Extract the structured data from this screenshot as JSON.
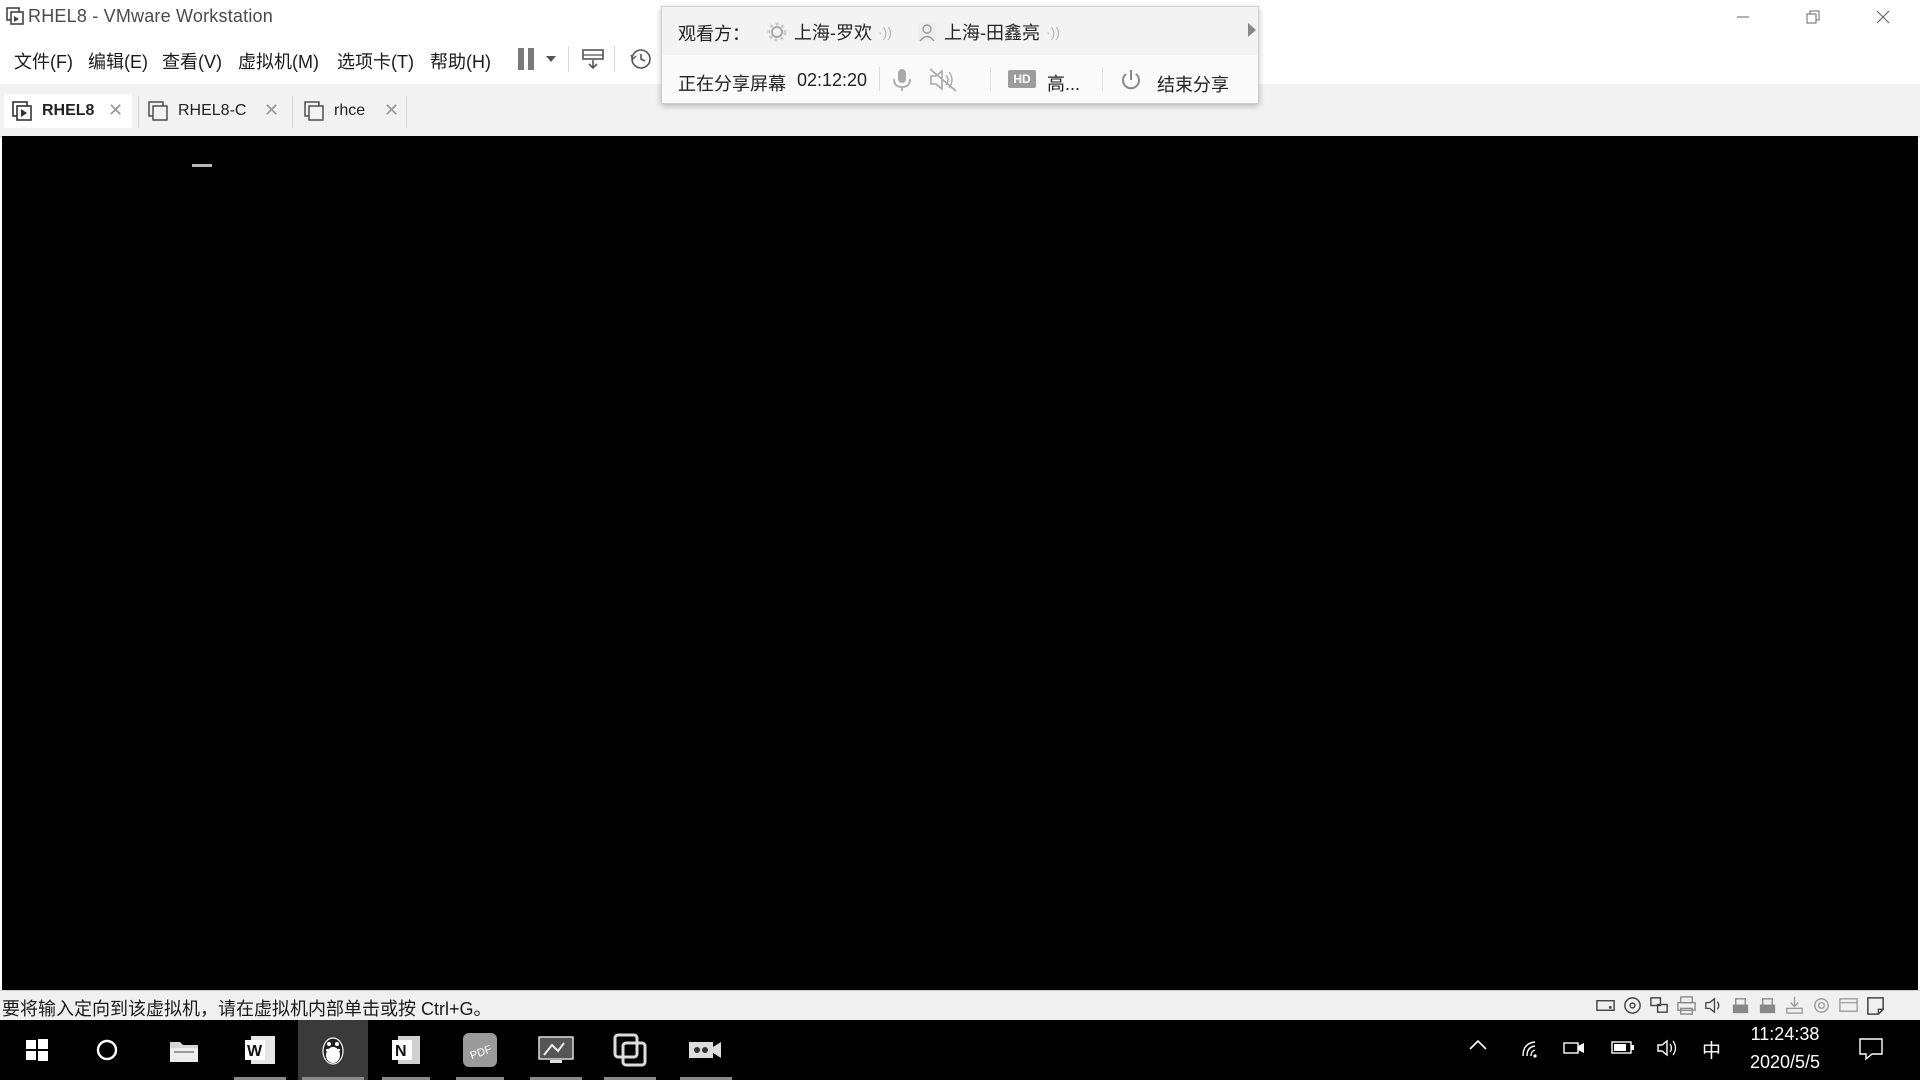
{
  "window": {
    "title": "RHEL8 - VMware Workstation",
    "icon": "vmware-window-icon"
  },
  "menu": {
    "items": [
      {
        "id": "file",
        "label": "文件(F)"
      },
      {
        "id": "edit",
        "label": "编辑(E)"
      },
      {
        "id": "view",
        "label": "查看(V)"
      },
      {
        "id": "vm",
        "label": "虚拟机(M)"
      },
      {
        "id": "tabs",
        "label": "选项卡(T)"
      },
      {
        "id": "help",
        "label": "帮助(H)"
      }
    ],
    "toolbar_icons": [
      "pause-icon",
      "dropdown-arrow-icon",
      "send-ctrl-alt-del-icon",
      "snapshot-icon"
    ]
  },
  "tabs": [
    {
      "label": "RHEL8",
      "active": true
    },
    {
      "label": "RHEL8-C",
      "active": false
    },
    {
      "label": "rhce",
      "active": false
    }
  ],
  "share_popup": {
    "viewers_label": "观看方：",
    "viewers": [
      {
        "name": "上海-罗欢",
        "avatar": "gear-avatar-icon"
      },
      {
        "name": "上海-田鑫亮",
        "avatar": "person-avatar-icon"
      }
    ],
    "status_label": "正在分享屏幕",
    "timer": "02:12:20",
    "quality_badge": "HD",
    "quality_label": "高...",
    "end_label": "结束分享"
  },
  "statusbar": {
    "message": "要将输入定向到该虚拟机，请在虚拟机内部单击或按 Ctrl+G。",
    "device_icons": [
      "hard-disk-icon",
      "cd-dvd-icon",
      "network-adapter-icon",
      "printer-icon",
      "sound-icon",
      "usb-icon",
      "usb-icon-2",
      "usb-download-icon",
      "camera-icon",
      "display-icon",
      "message-icon"
    ]
  },
  "taskbar": {
    "apps": [
      {
        "name": "start-button"
      },
      {
        "name": "cortana-search"
      },
      {
        "name": "file-explorer"
      },
      {
        "name": "word"
      },
      {
        "name": "qq",
        "active": true
      },
      {
        "name": "onenote"
      },
      {
        "name": "pdf-reader"
      },
      {
        "name": "screen-tool"
      },
      {
        "name": "vmware"
      },
      {
        "name": "video-recorder"
      }
    ],
    "tray": {
      "ime": "中",
      "time": "11:24:38",
      "date": "2020/5/5"
    }
  },
  "colors": {
    "console": "#000000",
    "taskbar": "#000000",
    "tab_bar": "#f2f2f2",
    "popup": "#fafafa"
  }
}
